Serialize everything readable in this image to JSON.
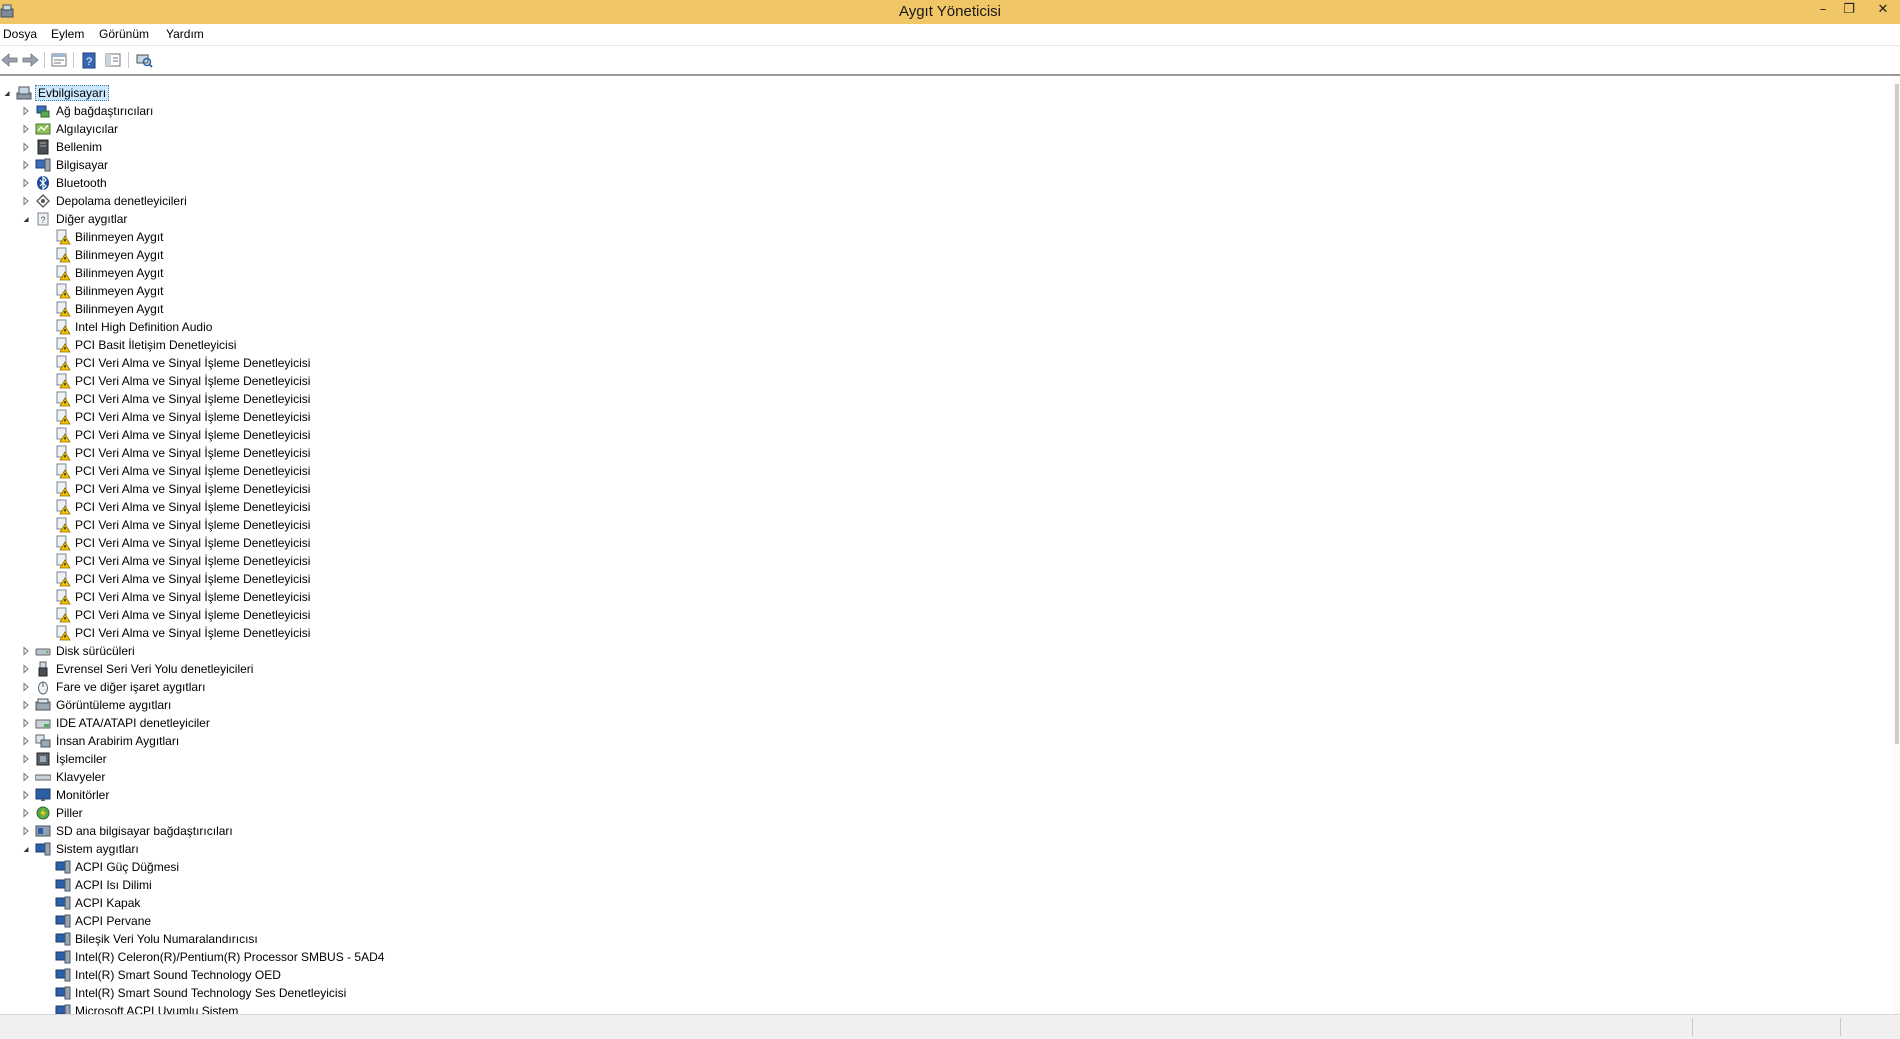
{
  "window": {
    "title": "Aygıt Yöneticisi"
  },
  "menu": [
    "Dosya",
    "Eylem",
    "Görünüm",
    "Yardım"
  ],
  "toolbar": {
    "buttons": [
      "back-arrow-icon",
      "forward-arrow-icon",
      "properties-panel-icon",
      "help-icon",
      "show-hide-tree-icon",
      "scan-hardware-icon"
    ]
  },
  "tree": {
    "root": "Evbilgisayarı",
    "categories": [
      {
        "label": "Ağ bağdaştırıcıları",
        "icon": "network-adapter-icon",
        "expanded": false
      },
      {
        "label": "Algılayıcılar",
        "icon": "sensor-icon",
        "expanded": false
      },
      {
        "label": "Bellenim",
        "icon": "firmware-icon",
        "expanded": false
      },
      {
        "label": "Bilgisayar",
        "icon": "computer-icon",
        "expanded": false
      },
      {
        "label": "Bluetooth",
        "icon": "bluetooth-icon",
        "expanded": false
      },
      {
        "label": "Depolama denetleyicileri",
        "icon": "storage-controller-icon",
        "expanded": false
      },
      {
        "label": "Diğer aygıtlar",
        "icon": "other-devices-icon",
        "expanded": true,
        "children": [
          {
            "label": "Bilinmeyen Aygıt",
            "icon": "warning-device-icon"
          },
          {
            "label": "Bilinmeyen Aygıt",
            "icon": "warning-device-icon"
          },
          {
            "label": "Bilinmeyen Aygıt",
            "icon": "warning-device-icon"
          },
          {
            "label": "Bilinmeyen Aygıt",
            "icon": "warning-device-icon"
          },
          {
            "label": "Bilinmeyen Aygıt",
            "icon": "warning-device-icon"
          },
          {
            "label": "Intel High Definition Audio",
            "icon": "warning-device-icon"
          },
          {
            "label": "PCI Basit İletişim Denetleyicisi",
            "icon": "warning-device-icon"
          },
          {
            "label": "PCI Veri Alma ve Sinyal İşleme Denetleyicisi",
            "icon": "warning-device-icon"
          },
          {
            "label": "PCI Veri Alma ve Sinyal İşleme Denetleyicisi",
            "icon": "warning-device-icon"
          },
          {
            "label": "PCI Veri Alma ve Sinyal İşleme Denetleyicisi",
            "icon": "warning-device-icon"
          },
          {
            "label": "PCI Veri Alma ve Sinyal İşleme Denetleyicisi",
            "icon": "warning-device-icon"
          },
          {
            "label": "PCI Veri Alma ve Sinyal İşleme Denetleyicisi",
            "icon": "warning-device-icon"
          },
          {
            "label": "PCI Veri Alma ve Sinyal İşleme Denetleyicisi",
            "icon": "warning-device-icon"
          },
          {
            "label": "PCI Veri Alma ve Sinyal İşleme Denetleyicisi",
            "icon": "warning-device-icon"
          },
          {
            "label": "PCI Veri Alma ve Sinyal İşleme Denetleyicisi",
            "icon": "warning-device-icon"
          },
          {
            "label": "PCI Veri Alma ve Sinyal İşleme Denetleyicisi",
            "icon": "warning-device-icon"
          },
          {
            "label": "PCI Veri Alma ve Sinyal İşleme Denetleyicisi",
            "icon": "warning-device-icon"
          },
          {
            "label": "PCI Veri Alma ve Sinyal İşleme Denetleyicisi",
            "icon": "warning-device-icon"
          },
          {
            "label": "PCI Veri Alma ve Sinyal İşleme Denetleyicisi",
            "icon": "warning-device-icon"
          },
          {
            "label": "PCI Veri Alma ve Sinyal İşleme Denetleyicisi",
            "icon": "warning-device-icon"
          },
          {
            "label": "PCI Veri Alma ve Sinyal İşleme Denetleyicisi",
            "icon": "warning-device-icon"
          },
          {
            "label": "PCI Veri Alma ve Sinyal İşleme Denetleyicisi",
            "icon": "warning-device-icon"
          },
          {
            "label": "PCI Veri Alma ve Sinyal İşleme Denetleyicisi",
            "icon": "warning-device-icon"
          }
        ]
      },
      {
        "label": "Disk sürücüleri",
        "icon": "disk-drive-icon",
        "expanded": false
      },
      {
        "label": "Evrensel Seri Veri Yolu denetleyicileri",
        "icon": "usb-icon",
        "expanded": false
      },
      {
        "label": "Fare ve diğer işaret aygıtları",
        "icon": "mouse-icon",
        "expanded": false
      },
      {
        "label": "Görüntüleme aygıtları",
        "icon": "imaging-device-icon",
        "expanded": false
      },
      {
        "label": "IDE ATA/ATAPI denetleyiciler",
        "icon": "ide-controller-icon",
        "expanded": false
      },
      {
        "label": "İnsan Arabirim Aygıtları",
        "icon": "hid-icon",
        "expanded": false
      },
      {
        "label": "İşlemciler",
        "icon": "processor-icon",
        "expanded": false
      },
      {
        "label": "Klavyeler",
        "icon": "keyboard-icon",
        "expanded": false
      },
      {
        "label": "Monitörler",
        "icon": "monitor-icon",
        "expanded": false
      },
      {
        "label": "Piller",
        "icon": "battery-icon",
        "expanded": false
      },
      {
        "label": "SD ana bilgisayar bağdaştırıcıları",
        "icon": "sd-host-icon",
        "expanded": false
      },
      {
        "label": "Sistem aygıtları",
        "icon": "system-device-icon",
        "expanded": true,
        "children": [
          {
            "label": "ACPI Güç Düğmesi",
            "icon": "system-device-icon"
          },
          {
            "label": "ACPI Isı Dilimi",
            "icon": "system-device-icon"
          },
          {
            "label": "ACPI Kapak",
            "icon": "system-device-icon"
          },
          {
            "label": "ACPI Pervane",
            "icon": "system-device-icon"
          },
          {
            "label": "Bileşik Veri Yolu Numaralandırıcısı",
            "icon": "system-device-icon"
          },
          {
            "label": "Intel(R) Celeron(R)/Pentium(R) Processor SMBUS - 5AD4",
            "icon": "system-device-icon"
          },
          {
            "label": "Intel(R) Smart Sound Technology OED",
            "icon": "system-device-icon"
          },
          {
            "label": "Intel(R) Smart Sound Technology Ses Denetleyicisi",
            "icon": "system-device-icon"
          },
          {
            "label": "Microsoft ACPI Uyumlu Sistem",
            "icon": "system-device-icon"
          }
        ]
      }
    ]
  },
  "colors": {
    "titlebar": "#f0c666",
    "selection": "#cce8ff",
    "warning": "#f5c400"
  }
}
